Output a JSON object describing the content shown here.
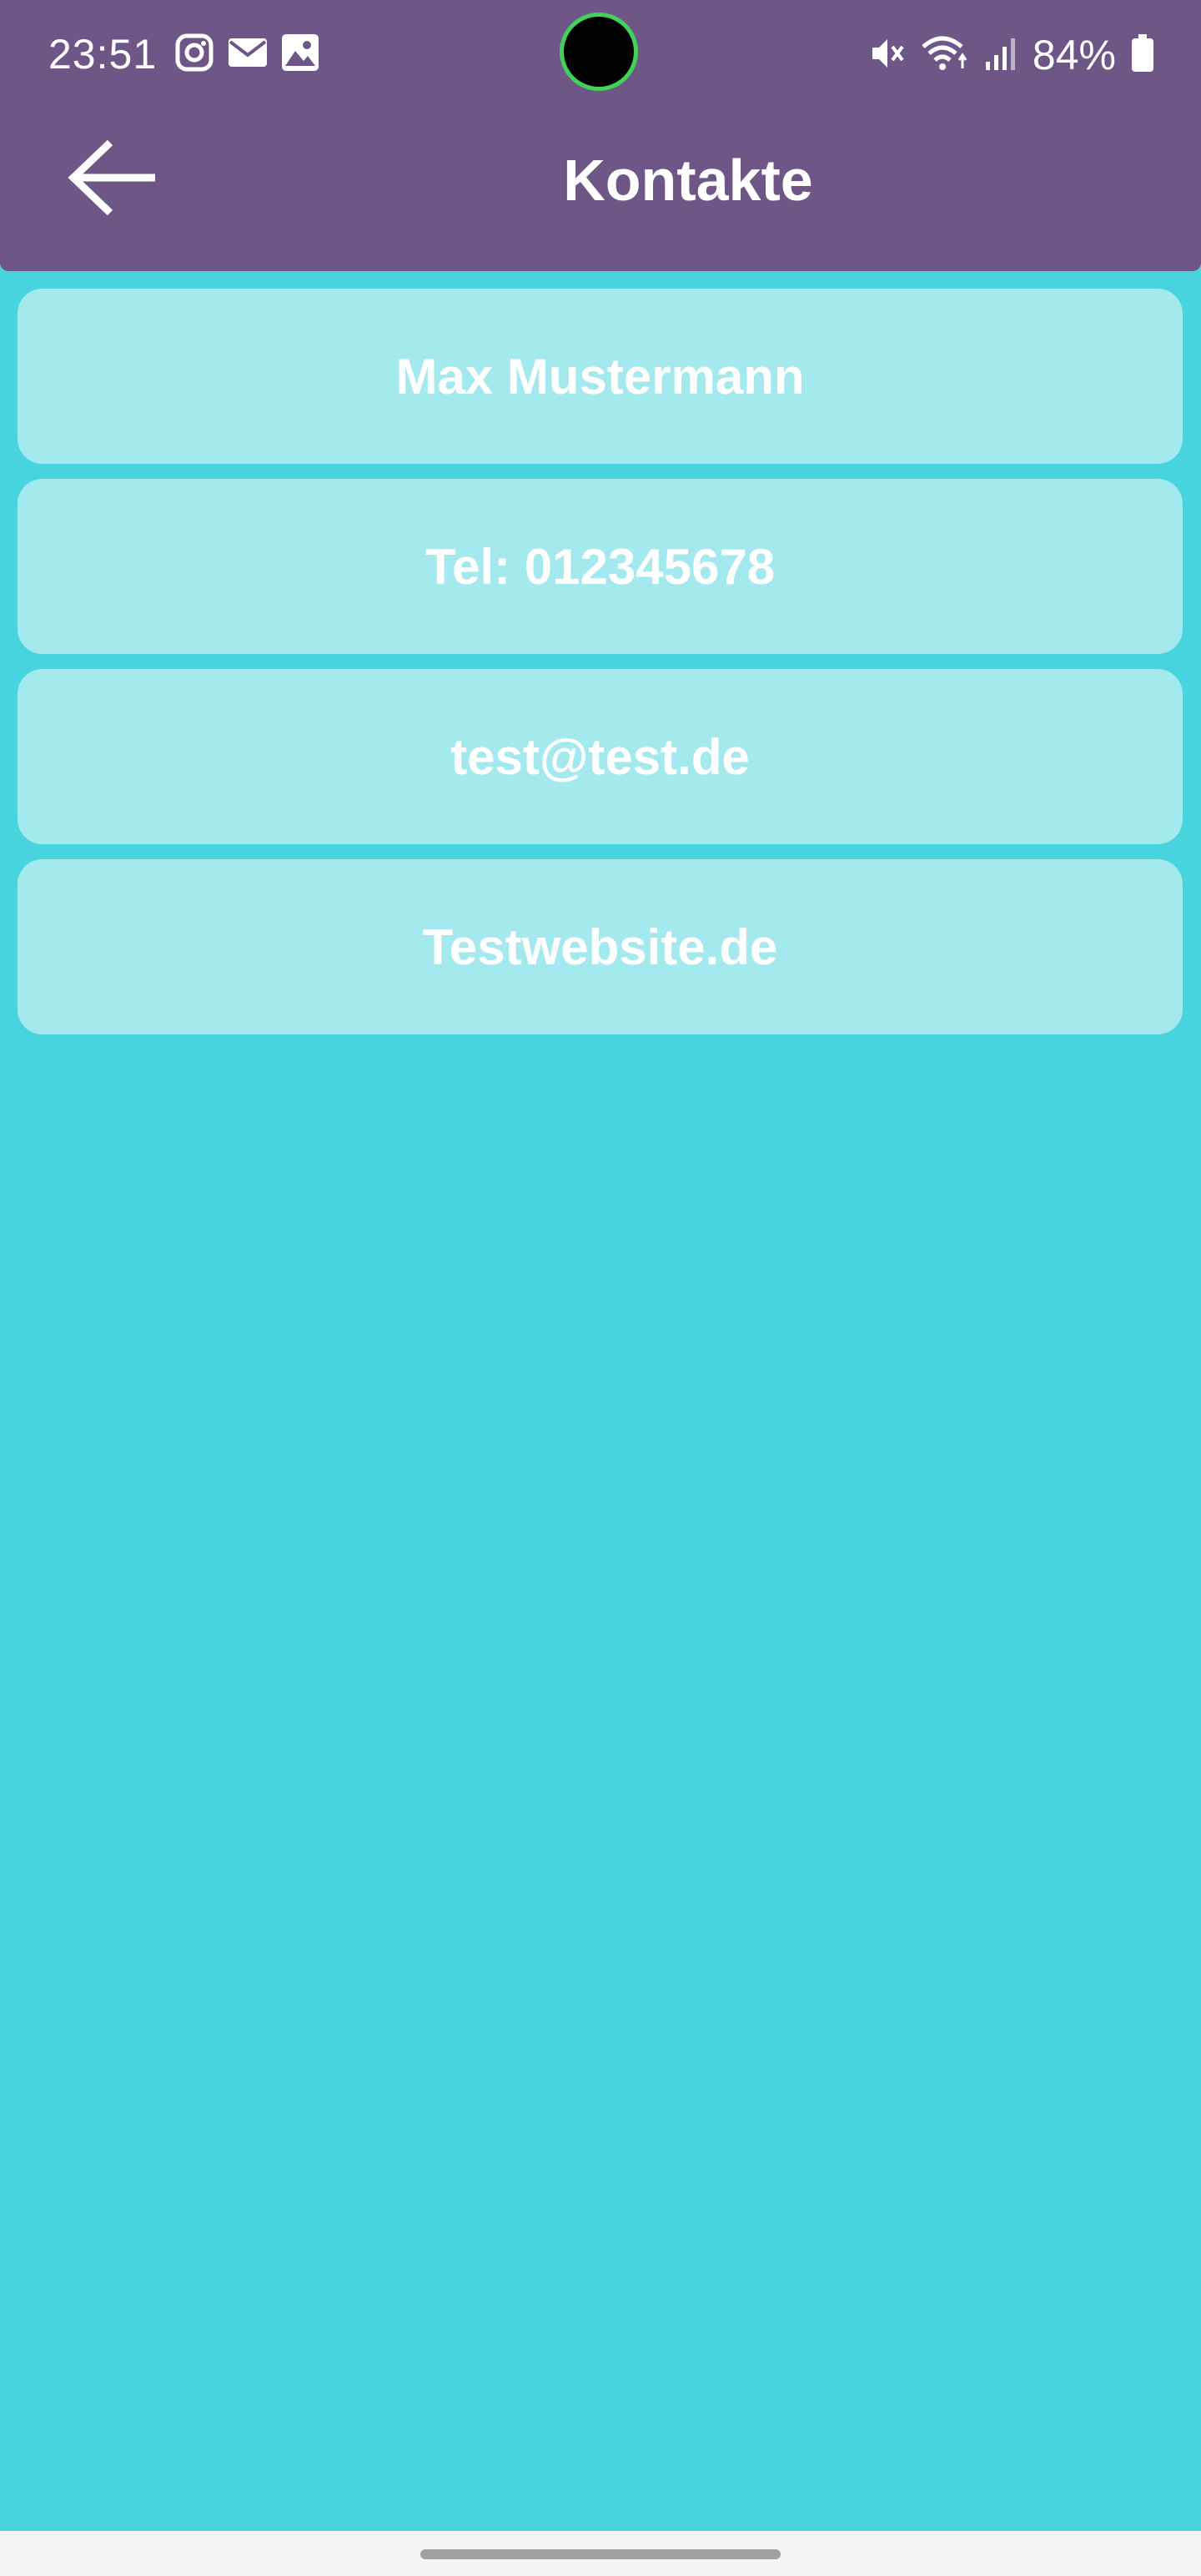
{
  "status_bar": {
    "time": "23:51",
    "battery": "84%",
    "left_icons": [
      "instagram-icon",
      "mail-icon",
      "image-icon"
    ],
    "right_icons": [
      "mute-icon",
      "wifi-icon",
      "signal-icon",
      "battery-icon"
    ]
  },
  "app_bar": {
    "title": "Kontakte",
    "back_icon": "arrow-left-icon"
  },
  "contact": {
    "fields": [
      {
        "label": "Max Mustermann"
      },
      {
        "label": "Tel: 012345678"
      },
      {
        "label": "test@test.de"
      },
      {
        "label": "Testwebsite.de"
      }
    ]
  },
  "colors": {
    "app_bar": "#6e5786",
    "background": "#48d4de",
    "card": "#a3e9ee",
    "text": "#ffffff",
    "camera_ring": "#41d25a"
  }
}
